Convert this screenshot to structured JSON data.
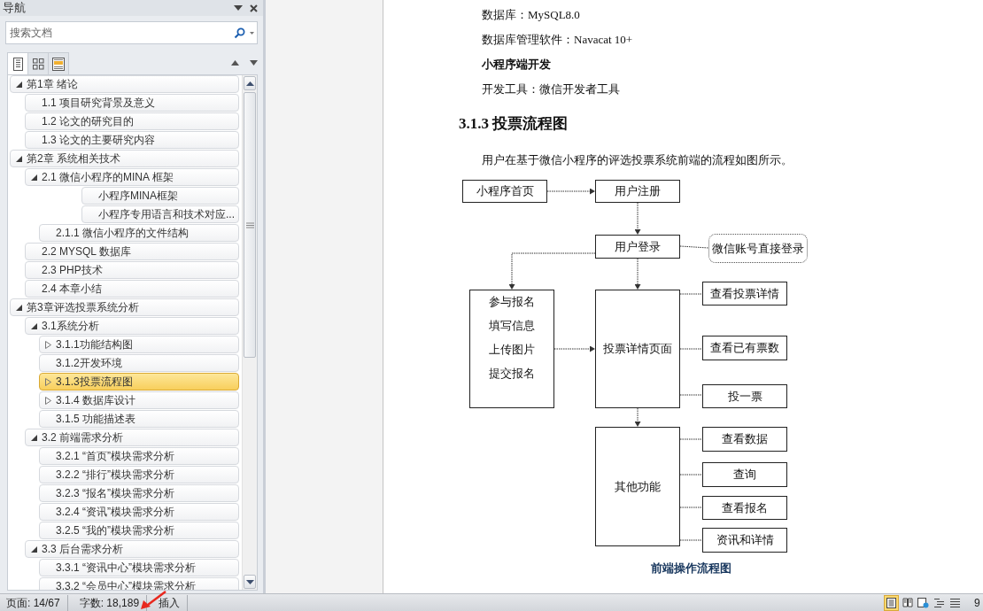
{
  "navigation": {
    "title": "导航",
    "search": {
      "placeholder": "搜索文档"
    },
    "view_tabs": [
      {
        "kind": "headings",
        "selected": true
      },
      {
        "kind": "pages",
        "selected": false
      },
      {
        "kind": "results",
        "selected": false
      }
    ],
    "outline": [
      {
        "text": "第1章  绪论",
        "kind": "node",
        "expanded": true,
        "selected": false,
        "children": [
          {
            "text": "1.1 项目研究背景及意义",
            "kind": "leaf",
            "selected": false
          },
          {
            "text": "1.2 论文的研究目的",
            "kind": "leaf",
            "selected": false
          },
          {
            "text": "1.3 论文的主要研究内容",
            "kind": "leaf",
            "selected": false
          }
        ]
      },
      {
        "text": "第2章  系统相关技术",
        "kind": "node",
        "expanded": true,
        "selected": false,
        "children": [
          {
            "text": "2.1 微信小程序的MINA 框架",
            "kind": "node",
            "expanded": true,
            "selected": false,
            "children": [
              {
                "text": "小程序MINA框架",
                "kind": "body",
                "selected": false
              },
              {
                "text": "小程序专用语言和技术对应...",
                "kind": "body",
                "selected": false
              },
              {
                "text": "2.1.1 微信小程序的文件结构",
                "kind": "leaf",
                "selected": false
              }
            ]
          },
          {
            "text": "2.2 MYSQL 数据库",
            "kind": "leaf",
            "selected": false
          },
          {
            "text": "2.3 PHP技术",
            "kind": "leaf",
            "selected": false
          },
          {
            "text": "2.4 本章小结",
            "kind": "leaf",
            "selected": false
          }
        ]
      },
      {
        "text": "第3章评选投票系统分析",
        "kind": "node",
        "expanded": true,
        "selected": false,
        "children": [
          {
            "text": "3.1系统分析",
            "kind": "node",
            "expanded": true,
            "selected": false,
            "children": [
              {
                "text": "3.1.1功能结构图",
                "kind": "node",
                "expanded": false,
                "selected": false
              },
              {
                "text": "3.1.2开发环境",
                "kind": "leaf",
                "selected": false
              },
              {
                "text": "3.1.3投票流程图",
                "kind": "node",
                "expanded": false,
                "selected": true
              },
              {
                "text": "3.1.4 数据库设计",
                "kind": "node",
                "expanded": false,
                "selected": false
              },
              {
                "text": "3.1.5 功能描述表",
                "kind": "leaf",
                "selected": false
              }
            ]
          },
          {
            "text": "3.2 前端需求分析",
            "kind": "node",
            "expanded": true,
            "selected": false,
            "children": [
              {
                "text": "3.2.1 “首页”模块需求分析",
                "kind": "leaf",
                "selected": false
              },
              {
                "text": "3.2.2 “排行”模块需求分析",
                "kind": "leaf",
                "selected": false
              },
              {
                "text": "3.2.3 “报名”模块需求分析",
                "kind": "leaf",
                "selected": false
              },
              {
                "text": "3.2.4 “资讯”模块需求分析",
                "kind": "leaf",
                "selected": false
              },
              {
                "text": "3.2.5 “我的”模块需求分析",
                "kind": "leaf",
                "selected": false
              }
            ]
          },
          {
            "text": "3.3 后台需求分析",
            "kind": "node",
            "expanded": true,
            "selected": false,
            "children": [
              {
                "text": "3.3.1 “资讯中心”模块需求分析",
                "kind": "leaf",
                "selected": false
              },
              {
                "text": "3.3.2 “会员中心”模块需求分析",
                "kind": "leaf",
                "selected": false
              }
            ]
          }
        ]
      }
    ]
  },
  "document": {
    "paragraphs": [
      {
        "kind": "text",
        "text": "数据库：MySQL8.0"
      },
      {
        "kind": "text",
        "text": "数据库管理软件：Navacat 10+"
      },
      {
        "kind": "bold",
        "text": "小程序端开发"
      },
      {
        "kind": "text",
        "text": "开发工具：微信开发者工具"
      }
    ],
    "heading": "3.1.3 投票流程图",
    "intro": "用户在基于微信小程序的评选投票系统前端的流程如图所示。",
    "flowchart": {
      "nodes": [
        {
          "kind": "box",
          "lines": [
            "小程序首页"
          ]
        },
        {
          "kind": "box",
          "lines": [
            "用户注册"
          ]
        },
        {
          "kind": "box",
          "lines": [
            "用户登录"
          ]
        },
        {
          "kind": "callout",
          "lines": [
            "微信账号直接登录"
          ]
        },
        {
          "kind": "box",
          "lines": [
            "参与报名",
            "填写信息",
            "上传图片",
            "提交报名"
          ]
        },
        {
          "kind": "box",
          "lines": [
            "投票详情页面"
          ]
        },
        {
          "kind": "box",
          "lines": [
            "查看投票详情"
          ]
        },
        {
          "kind": "box",
          "lines": [
            "查看已有票数"
          ]
        },
        {
          "kind": "box",
          "lines": [
            "投一票"
          ]
        },
        {
          "kind": "box",
          "lines": [
            "其他功能"
          ]
        },
        {
          "kind": "box",
          "lines": [
            "查看数据"
          ]
        },
        {
          "kind": "box",
          "lines": [
            "查询"
          ]
        },
        {
          "kind": "box",
          "lines": [
            "查看报名"
          ]
        },
        {
          "kind": "box",
          "lines": [
            "资讯和详情"
          ]
        }
      ]
    },
    "caption": "前端操作流程图"
  },
  "status_bar": {
    "items": [
      "页面: 14/67",
      "字数: 18,189",
      "插入"
    ],
    "view_buttons": [
      {
        "kind": "print",
        "selected": true
      },
      {
        "kind": "reading",
        "selected": false
      },
      {
        "kind": "web",
        "selected": false
      },
      {
        "kind": "outline",
        "selected": false
      },
      {
        "kind": "draft",
        "selected": false
      }
    ],
    "zoom": "9"
  }
}
